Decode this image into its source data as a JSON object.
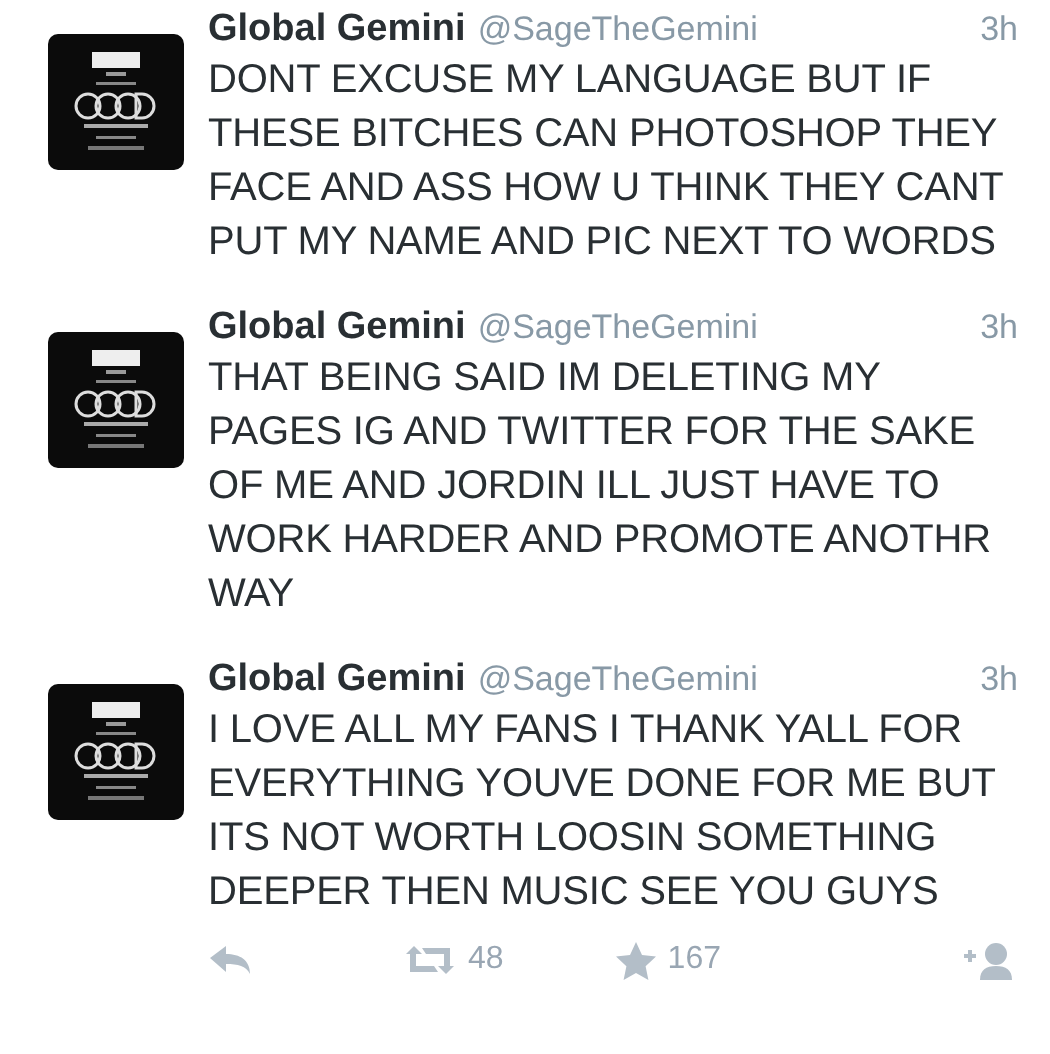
{
  "tweets": [
    {
      "name": "Global Gemini",
      "handle": "@SageTheGemini",
      "time": "3h",
      "text": "DONT EXCUSE MY LANGUAGE BUT IF THESE BITCHES CAN PHOTOSHOP THEY FACE AND ASS HOW U THINK THEY CANT PUT MY NAME AND PIC NEXT TO WORDS"
    },
    {
      "name": "Global Gemini",
      "handle": "@SageTheGemini",
      "time": "3h",
      "text": "THAT BEING SAID IM DELETING MY PAGES IG AND TWITTER FOR THE SAKE OF ME AND JORDIN ILL JUST HAVE TO WORK HARDER AND PROMOTE ANOTHR WAY"
    },
    {
      "name": "Global Gemini",
      "handle": "@SageTheGemini",
      "time": "3h",
      "text": "I LOVE ALL MY FANS I THANK YALL FOR EVERYTHING YOUVE DONE FOR ME BUT ITS NOT WORTH LOOSIN SOMETHING DEEPER THEN MUSIC SEE YOU GUYS",
      "actions": {
        "retweets": "48",
        "favorites": "167"
      }
    }
  ]
}
